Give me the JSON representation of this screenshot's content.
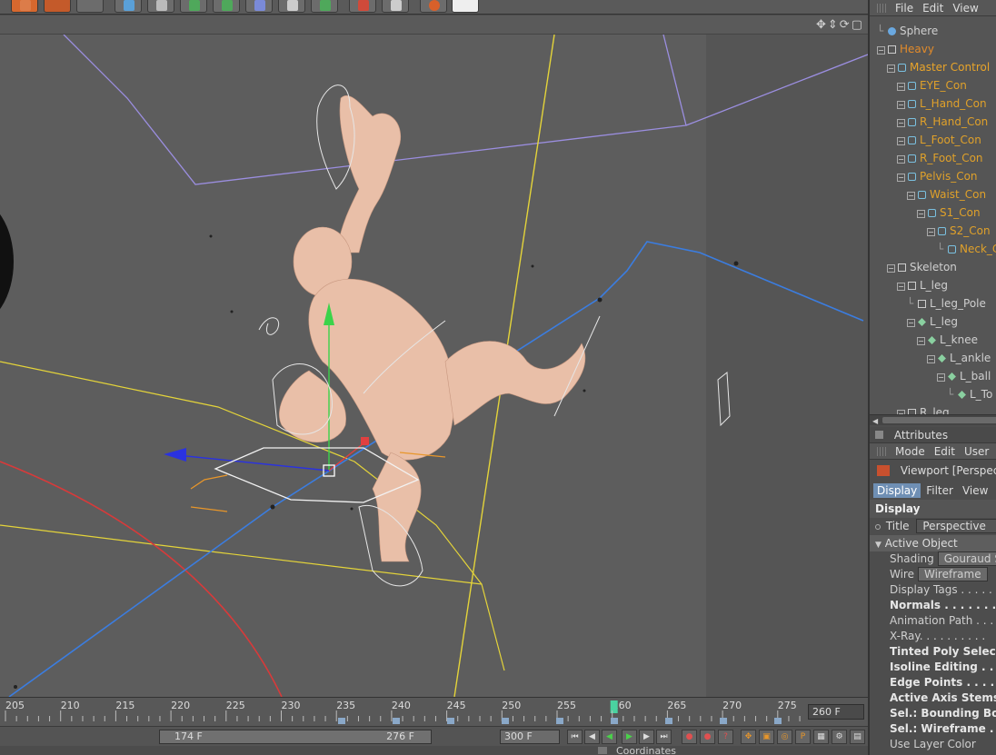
{
  "right_menu": [
    "File",
    "Edit",
    "View"
  ],
  "viewport_nav_icons": [
    "move-view-icon",
    "dolly-icon",
    "rotate-view-icon",
    "maximize-icon"
  ],
  "tree": [
    {
      "label": "Sphere",
      "indent": 0,
      "color": "#cfcfcf",
      "icon": "sphere-icon",
      "expander": false
    },
    {
      "label": "Heavy",
      "indent": 0,
      "color": "#e28b2a",
      "icon": "null-icon",
      "expander": true
    },
    {
      "label": "Master Control",
      "indent": 1,
      "color": "#e8a42a",
      "icon": "spline-icon",
      "expander": true
    },
    {
      "label": "EYE_Con",
      "indent": 2,
      "color": "#e0a12a",
      "icon": "spline-icon",
      "expander": true
    },
    {
      "label": "L_Hand_Con",
      "indent": 2,
      "color": "#e0a12a",
      "icon": "spline-icon",
      "expander": true
    },
    {
      "label": "R_Hand_Con",
      "indent": 2,
      "color": "#e0a12a",
      "icon": "spline-icon",
      "expander": true
    },
    {
      "label": "L_Foot_Con",
      "indent": 2,
      "color": "#e0a12a",
      "icon": "spline-icon",
      "expander": true
    },
    {
      "label": "R_Foot_Con",
      "indent": 2,
      "color": "#e0a12a",
      "icon": "spline-icon",
      "expander": true
    },
    {
      "label": "Pelvis_Con",
      "indent": 2,
      "color": "#e0a12a",
      "icon": "spline-icon",
      "expander": true
    },
    {
      "label": "Waist_Con",
      "indent": 3,
      "color": "#e0a12a",
      "icon": "spline-icon",
      "expander": true
    },
    {
      "label": "S1_Con",
      "indent": 4,
      "color": "#e0a12a",
      "icon": "spline-icon",
      "expander": true
    },
    {
      "label": "S2_Con",
      "indent": 5,
      "color": "#e0a12a",
      "icon": "spline-icon",
      "expander": true
    },
    {
      "label": "Neck_C",
      "indent": 6,
      "color": "#e0a12a",
      "icon": "spline-icon",
      "expander": false
    },
    {
      "label": "Skeleton",
      "indent": 1,
      "color": "#cfcfcf",
      "icon": "null-icon",
      "expander": true
    },
    {
      "label": "L_leg",
      "indent": 2,
      "color": "#cfcfcf",
      "icon": "null-icon",
      "expander": true
    },
    {
      "label": "L_leg_Pole",
      "indent": 3,
      "color": "#cfcfcf",
      "icon": "null-icon",
      "expander": false
    },
    {
      "label": "L_leg",
      "indent": 3,
      "color": "#cfcfcf",
      "icon": "joint-icon",
      "expander": true
    },
    {
      "label": "L_knee",
      "indent": 4,
      "color": "#cfcfcf",
      "icon": "joint-icon",
      "expander": true
    },
    {
      "label": "L_ankle",
      "indent": 5,
      "color": "#cfcfcf",
      "icon": "joint-icon",
      "expander": true
    },
    {
      "label": "L_ball",
      "indent": 6,
      "color": "#cfcfcf",
      "icon": "joint-icon",
      "expander": true
    },
    {
      "label": "L_To",
      "indent": 7,
      "color": "#cfcfcf",
      "icon": "joint-icon",
      "expander": false
    },
    {
      "label": "R_leg",
      "indent": 2,
      "color": "#cfcfcf",
      "icon": "null-icon",
      "expander": true
    }
  ],
  "attributes": {
    "title": "Attributes",
    "menu": [
      "Mode",
      "Edit",
      "User"
    ],
    "object_label": "Viewport [Perspect",
    "tabs": [
      "Display",
      "Filter",
      "View"
    ],
    "section": "Display",
    "title_field_label": "Title",
    "title_field_value": "Perspective",
    "group": "Active Object",
    "rows": [
      {
        "label": "Shading",
        "value": "Gouraud S",
        "bold": false
      },
      {
        "label": "Wire",
        "value": "Wireframe",
        "bold": false
      },
      {
        "label": "Display Tags . . . . . . .",
        "value": "",
        "bold": false
      },
      {
        "label": "Normals . . . . . . . .",
        "value": "",
        "bold": true
      },
      {
        "label": "Animation Path . . . .",
        "value": "",
        "bold": false
      },
      {
        "label": "X-Ray. . . . . . . . . .",
        "value": "",
        "bold": false
      },
      {
        "label": "Tinted Poly Selec",
        "value": "",
        "bold": true
      },
      {
        "label": "Isoline Editing . . .",
        "value": "",
        "bold": true
      },
      {
        "label": "Edge Points . . . . .",
        "value": "",
        "bold": true
      },
      {
        "label": "Active Axis Stems",
        "value": "",
        "bold": true
      },
      {
        "label": "Sel.: Bounding Bo",
        "value": "",
        "bold": true
      },
      {
        "label": "Sel.: Wireframe . . .",
        "value": "",
        "bold": true
      },
      {
        "label": "Use Layer Color",
        "value": "",
        "bold": false
      }
    ]
  },
  "timeline": {
    "ticks": [
      "205",
      "210",
      "215",
      "220",
      "225",
      "230",
      "235",
      "240",
      "245",
      "250",
      "255",
      "260",
      "265",
      "270",
      "275"
    ],
    "current_tick": "260",
    "current_frame_field": "260 F"
  },
  "playback": {
    "range_start": "174 F",
    "range_end": "276 F",
    "max_frame": "300 F"
  },
  "bottom_panel": {
    "coordinates_label": "Coordinates"
  },
  "colors": {
    "accent_orange": "#e28b2a",
    "accent_blue": "#6f8fb4",
    "viewport_bg": "#5d5d5d"
  }
}
